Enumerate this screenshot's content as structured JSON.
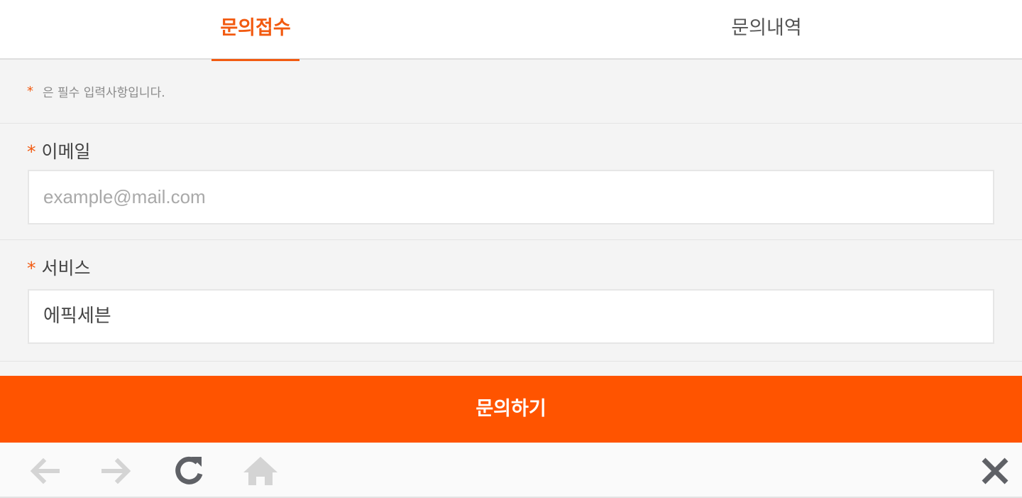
{
  "tabs": {
    "inquiry_submit": "문의접수",
    "inquiry_history": "문의내역"
  },
  "notice": {
    "star": "*",
    "text": "은 필수 입력사항입니다."
  },
  "email": {
    "required_mark": "*",
    "label": "이메일",
    "placeholder": "example@mail.com",
    "value": ""
  },
  "service": {
    "required_mark": "*",
    "label": "서비스",
    "value": "에픽세븐"
  },
  "submit_label": "문의하기",
  "colors": {
    "accent": "#f25a10",
    "submit_bg": "#ff5400"
  },
  "browser_bar": {
    "icons": [
      "back-arrow-icon",
      "forward-arrow-icon",
      "refresh-icon",
      "home-icon",
      "close-icon"
    ]
  }
}
